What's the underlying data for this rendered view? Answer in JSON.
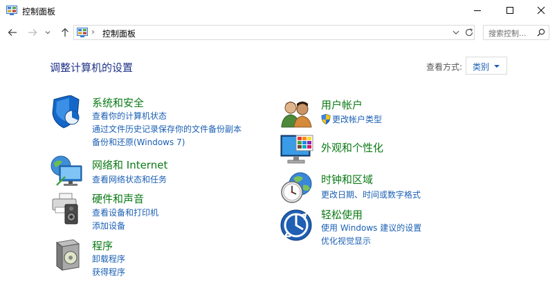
{
  "window": {
    "title": "控制面板"
  },
  "address": {
    "path": "控制面板",
    "separator": "›"
  },
  "search": {
    "placeholder": "搜索控制..."
  },
  "main": {
    "heading": "调整计算机的设置",
    "view_by_label": "查看方式:",
    "view_by_value": "类别"
  },
  "categories": {
    "system_security": {
      "title": "系统和安全",
      "links": [
        "查看你的计算机状态",
        "通过文件历史记录保存你的文件备份副本",
        "备份和还原(Windows 7)"
      ]
    },
    "network": {
      "title": "网络和 Internet",
      "links": [
        "查看网络状态和任务"
      ]
    },
    "hardware": {
      "title": "硬件和声音",
      "links": [
        "查看设备和打印机",
        "添加设备"
      ]
    },
    "programs": {
      "title": "程序",
      "links": [
        "卸载程序",
        "获得程序"
      ]
    },
    "user_accounts": {
      "title": "用户帐户",
      "links": [
        "更改帐户类型"
      ]
    },
    "appearance": {
      "title": "外观和个性化",
      "links": []
    },
    "clock_region": {
      "title": "时钟和区域",
      "links": [
        "更改日期、时间或数字格式"
      ]
    },
    "ease_of_access": {
      "title": "轻松使用",
      "links": [
        "使用 Windows 建议的设置",
        "优化视觉显示"
      ]
    }
  },
  "colors": {
    "category_title": "#0a7a15",
    "link": "#1a5fb4",
    "heading": "#1e3287"
  }
}
